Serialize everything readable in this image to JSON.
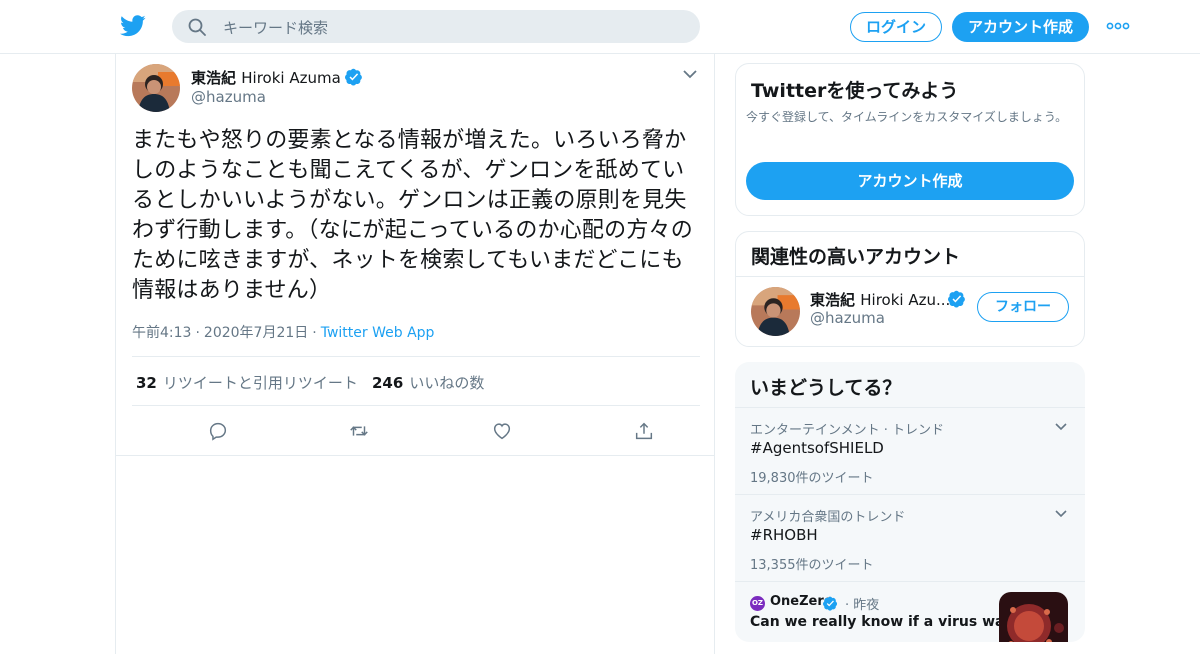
{
  "header": {
    "search_placeholder": "キーワード検索",
    "login_label": "ログイン",
    "signup_label": "アカウント作成"
  },
  "tweet": {
    "author_name_ja": "東浩紀",
    "author_name_latin": "Hiroki Azuma",
    "author_handle": "@hazuma",
    "text": "またもや怒りの要素となる情報が増えた。いろいろ脅かしのようなことも聞こえてくるが、ゲンロンを舐めているとしかいいようがない。ゲンロンは正義の原則を見失わず行動します。（なにが起こっているのか心配の方々のために呟きますが、ネットを検索してもいまだどこにも情報はありません）",
    "time": "午前4:13",
    "date": "2020年7月21日",
    "client": "Twitter Web App",
    "retweet_count": "32",
    "retweet_label": "リツイートと引用リツイート",
    "like_count": "246",
    "like_label": "いいねの数"
  },
  "try_card": {
    "title": "Twitterを使ってみよう",
    "description": "今すぐ登録して、タイムラインをカスタマイズしましょう。",
    "cta_label": "アカウント作成"
  },
  "related": {
    "title": "関連性の高いアカウント",
    "name_ja": "東浩紀",
    "name_latin": "Hiroki Azu...",
    "handle": "@hazuma",
    "follow_label": "フォロー"
  },
  "trends": {
    "title": "いまどうしてる？",
    "items": [
      {
        "context": "エンターテインメント · トレンド",
        "tag": "#AgentsofSHIELD",
        "count": "19,830件のツイート"
      },
      {
        "context": "アメリカ合衆国のトレンド",
        "tag": "#RHOBH",
        "count": "13,355件のツイート"
      }
    ],
    "news": {
      "source_logo": "OZ",
      "source": "OneZero",
      "time": "· 昨夜",
      "headline": "Can we really know if a virus was"
    }
  },
  "colors": {
    "accent": "#1da1f2",
    "muted": "#657786",
    "text": "#14171a",
    "border": "#e6ecf0"
  }
}
